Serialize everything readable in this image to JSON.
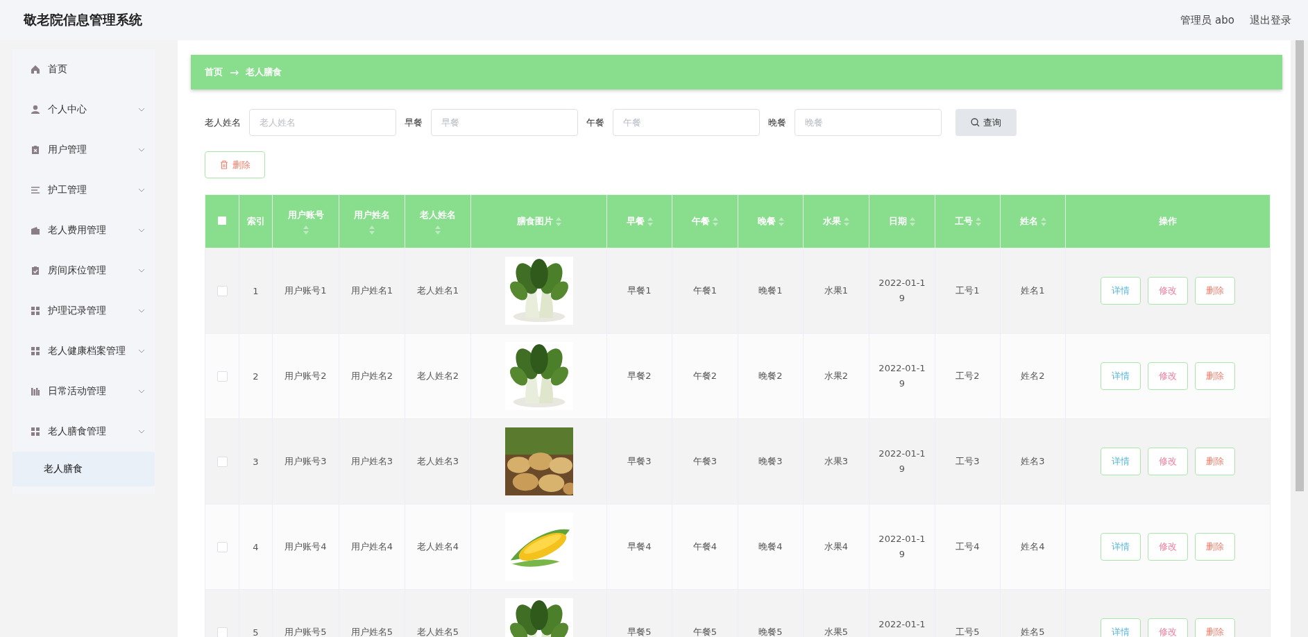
{
  "header": {
    "title": "敬老院信息管理系统",
    "user": "管理员 abo",
    "logout": "退出登录"
  },
  "sidebar": {
    "items": [
      {
        "label": "首页",
        "expandable": false
      },
      {
        "label": "个人中心",
        "expandable": true
      },
      {
        "label": "用户管理",
        "expandable": true
      },
      {
        "label": "护工管理",
        "expandable": true
      },
      {
        "label": "老人费用管理",
        "expandable": true
      },
      {
        "label": "房间床位管理",
        "expandable": true
      },
      {
        "label": "护理记录管理",
        "expandable": true
      },
      {
        "label": "老人健康档案管理",
        "expandable": true
      },
      {
        "label": "日常活动管理",
        "expandable": true
      },
      {
        "label": "老人膳食管理",
        "expandable": true,
        "children": [
          {
            "label": "老人膳食",
            "selected": true
          }
        ]
      }
    ]
  },
  "breadcrumb": {
    "items": [
      "首页",
      "老人膳食"
    ],
    "separator": "→"
  },
  "search": {
    "fields": [
      {
        "label": "老人姓名",
        "placeholder": "老人姓名"
      },
      {
        "label": "早餐",
        "placeholder": "早餐"
      },
      {
        "label": "午餐",
        "placeholder": "午餐"
      },
      {
        "label": "晚餐",
        "placeholder": "晚餐"
      }
    ],
    "button": "查询"
  },
  "toolbar": {
    "delete_button": "删除"
  },
  "table": {
    "select_all_checked": false,
    "columns": [
      {
        "label": "索引",
        "sortable": false
      },
      {
        "label": "用户账号",
        "sortable": true
      },
      {
        "label": "用户姓名",
        "sortable": true
      },
      {
        "label": "老人姓名",
        "sortable": true
      },
      {
        "label": "膳食图片",
        "sortable": true
      },
      {
        "label": "早餐",
        "sortable": true
      },
      {
        "label": "午餐",
        "sortable": true
      },
      {
        "label": "晚餐",
        "sortable": true
      },
      {
        "label": "水果",
        "sortable": true
      },
      {
        "label": "日期",
        "sortable": true
      },
      {
        "label": "工号",
        "sortable": true
      },
      {
        "label": "姓名",
        "sortable": true
      },
      {
        "label": "操作",
        "sortable": false
      }
    ],
    "rows": [
      {
        "checked": false,
        "index": "1",
        "account": "用户账号1",
        "user_name": "用户姓名1",
        "elder_name": "老人姓名1",
        "image": {
          "kind": "picture"
        },
        "breakfast": "早餐1",
        "lunch": "午餐1",
        "dinner": "晚餐1",
        "fruit": "水果1",
        "date": "2022-01-19",
        "staff_no": "工号1",
        "name": "姓名1",
        "actions": [
          "详情",
          "修改",
          "删除"
        ]
      },
      {
        "checked": false,
        "index": "2",
        "account": "用户账号2",
        "user_name": "用户姓名2",
        "elder_name": "老人姓名2",
        "image": {
          "kind": "picture"
        },
        "breakfast": "早餐2",
        "lunch": "午餐2",
        "dinner": "晚餐2",
        "fruit": "水果2",
        "date": "2022-01-19",
        "staff_no": "工号2",
        "name": "姓名2",
        "actions": [
          "详情",
          "修改",
          "删除"
        ]
      },
      {
        "checked": false,
        "index": "3",
        "account": "用户账号3",
        "user_name": "用户姓名3",
        "elder_name": "老人姓名3",
        "image": {
          "kind": "picture"
        },
        "breakfast": "早餐3",
        "lunch": "午餐3",
        "dinner": "晚餐3",
        "fruit": "水果3",
        "date": "2022-01-19",
        "staff_no": "工号3",
        "name": "姓名3",
        "actions": [
          "详情",
          "修改",
          "删除"
        ]
      },
      {
        "checked": false,
        "index": "4",
        "account": "用户账号4",
        "user_name": "用户姓名4",
        "elder_name": "老人姓名4",
        "image": {
          "kind": "picture"
        },
        "breakfast": "早餐4",
        "lunch": "午餐4",
        "dinner": "晚餐4",
        "fruit": "水果4",
        "date": "2022-01-19",
        "staff_no": "工号4",
        "name": "姓名4",
        "actions": [
          "详情",
          "修改",
          "删除"
        ]
      },
      {
        "checked": false,
        "index": "5",
        "account": "用户账号5",
        "user_name": "用户姓名5",
        "elder_name": "老人姓名5",
        "image": {
          "kind": "picture"
        },
        "breakfast": "早餐5",
        "lunch": "午餐5",
        "dinner": "晚餐5",
        "fruit": "水果5",
        "date": "2022-01-1",
        "staff_no": "工号5",
        "name": "姓名5",
        "actions": [
          "详情",
          "修改",
          "删除"
        ]
      }
    ]
  }
}
